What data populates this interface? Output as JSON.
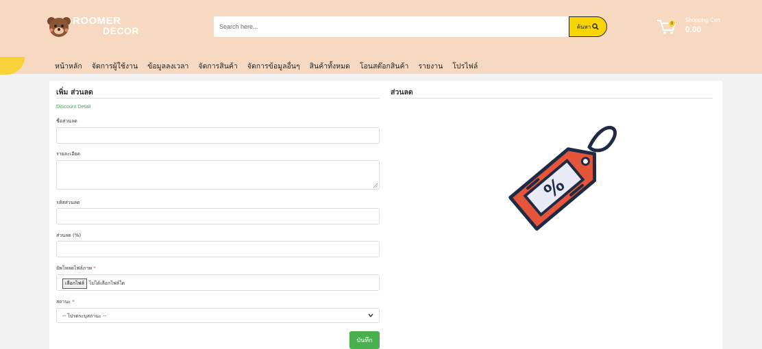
{
  "brand": {
    "line1": "ROOMER",
    "line2": "DECOR"
  },
  "search": {
    "placeholder": "Search here...",
    "button_label": "ค้นหา",
    "icon": "search-icon"
  },
  "cart": {
    "label": "Shopping Cart",
    "total": "0.00",
    "count": "0",
    "icon": "cart-icon"
  },
  "nav": {
    "items": [
      "หน้าหลัก",
      "จัดการผู้ใช้งาน",
      "ข้อมูลลงเวลา",
      "จัดการสินค้า",
      "จัดการข้อมูลอื่นๆ",
      "สินค้าทั้งหมด",
      "โอนสต๊อกสินค้า",
      "รายงาน",
      "โปรไฟล์"
    ]
  },
  "form": {
    "title": "เพิ่ม ส่วนลด",
    "subtitle": "Discount Detail",
    "name_label": "ชื่อส่วนลด",
    "detail_label": "รายละเอียด",
    "code_label": "รหัสส่วนลด",
    "percent_label": "ส่วนลด (%)",
    "image_label": "อัพโหลดไฟล์ภาพ",
    "status_label": "สถานะ",
    "required_mark": "*",
    "file_button": "เลือกไฟล์",
    "file_status": "ไม่ได้เลือกไฟล์ใด",
    "status_value": "-- โปรดระบุสถานะ --",
    "save_label": "บันทึก"
  },
  "preview": {
    "title": "ส่วนลด",
    "tag_text": "%"
  },
  "colors": {
    "header": "#f6d9c0",
    "accent": "#f8d500",
    "save": "#48b04e",
    "tag": "#e4553a"
  }
}
